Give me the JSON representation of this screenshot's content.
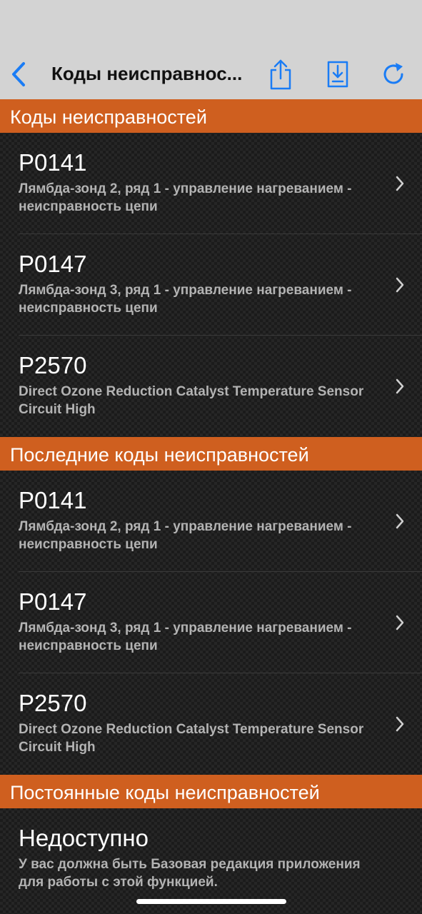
{
  "navbar": {
    "title": "Коды неисправнос...",
    "back_icon": "chevron-left-icon",
    "share_icon": "share-icon",
    "export_icon": "download-document-icon",
    "refresh_icon": "refresh-icon",
    "accent_color": "#1a7cf5"
  },
  "colors": {
    "section_header": "#cf5f1f",
    "row_title": "#ffffff",
    "row_desc": "#b3b3b3"
  },
  "sections": [
    {
      "header": "Коды неисправностей",
      "items": [
        {
          "code": "P0141",
          "desc": "Лямбда-зонд 2, ряд 1 - управление нагреванием - неисправность цепи"
        },
        {
          "code": "P0147",
          "desc": "Лямбда-зонд 3, ряд 1 - управление нагреванием - неисправность цепи"
        },
        {
          "code": "P2570",
          "desc": "Direct Ozone Reduction Catalyst Temperature Sensor Circuit High"
        }
      ]
    },
    {
      "header": "Последние коды неисправностей",
      "items": [
        {
          "code": "P0141",
          "desc": "Лямбда-зонд 2, ряд 1 - управление нагреванием - неисправность цепи"
        },
        {
          "code": "P0147",
          "desc": "Лямбда-зонд 3, ряд 1 - управление нагреванием - неисправность цепи"
        },
        {
          "code": "P2570",
          "desc": "Direct Ozone Reduction Catalyst Temperature Sensor Circuit High"
        }
      ]
    },
    {
      "header": "Постоянные коды неисправностей",
      "items": [
        {
          "code": "Недоступно",
          "desc": "У вас должна быть Базовая редакция приложения для работы с этой функцией."
        }
      ]
    }
  ]
}
